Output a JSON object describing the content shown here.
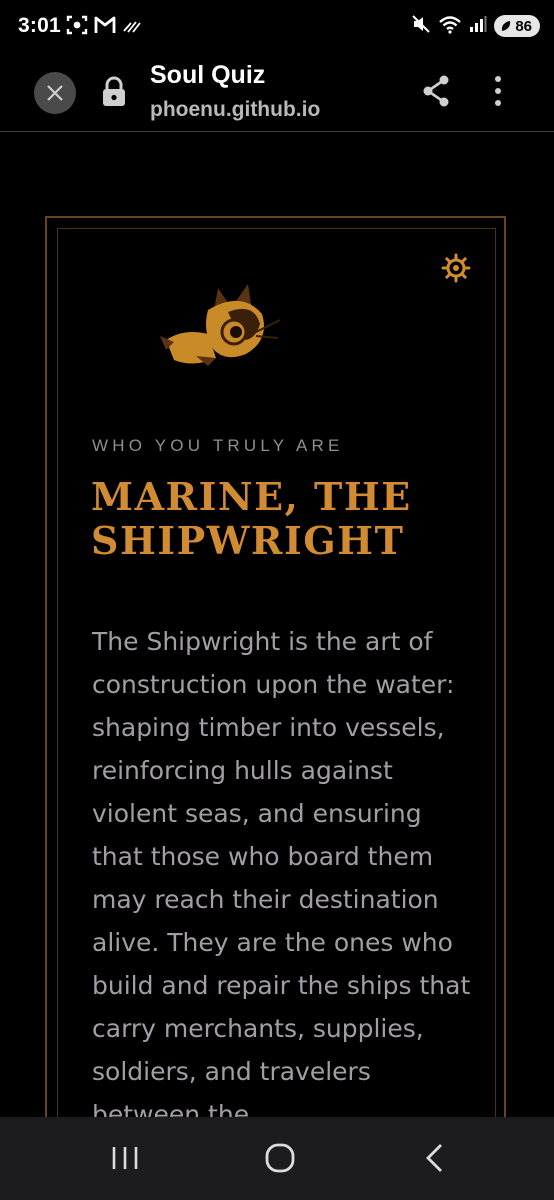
{
  "status_bar": {
    "time": "3:01",
    "battery_level": "86",
    "left_icons": [
      "screenshot-icon",
      "gmail-icon",
      "signal-bars-icon"
    ],
    "right_icons": [
      "mute-icon",
      "wifi-icon",
      "cell-signal-icon",
      "battery-icon"
    ]
  },
  "browser": {
    "title": "Soul Quiz",
    "url": "phoenu.github.io",
    "buttons": [
      "close-icon",
      "lock-icon",
      "share-icon",
      "more-vert-icon"
    ]
  },
  "result": {
    "eyebrow": "WHO YOU TRULY ARE",
    "title": "MARINE, THE SHIPWRIGHT",
    "description": "The Shipwright is the art of construction upon the water: shaping timber into vessels, reinforcing hulls against violent seas, and ensuring that those who board them may reach their destination alive. They are the ones who build and repair the ships that carry merchants, supplies, soldiers, and travelers between the"
  },
  "colors": {
    "background": "#000000",
    "accent_gold": "#d08b33",
    "frame_border": "#6b4321",
    "body_text": "#a39ea6",
    "eyebrow_text": "#8e8e93",
    "nav_bar": "#1c1c1e"
  },
  "nav": {
    "buttons": [
      "recents-icon",
      "home-icon",
      "back-icon"
    ]
  }
}
